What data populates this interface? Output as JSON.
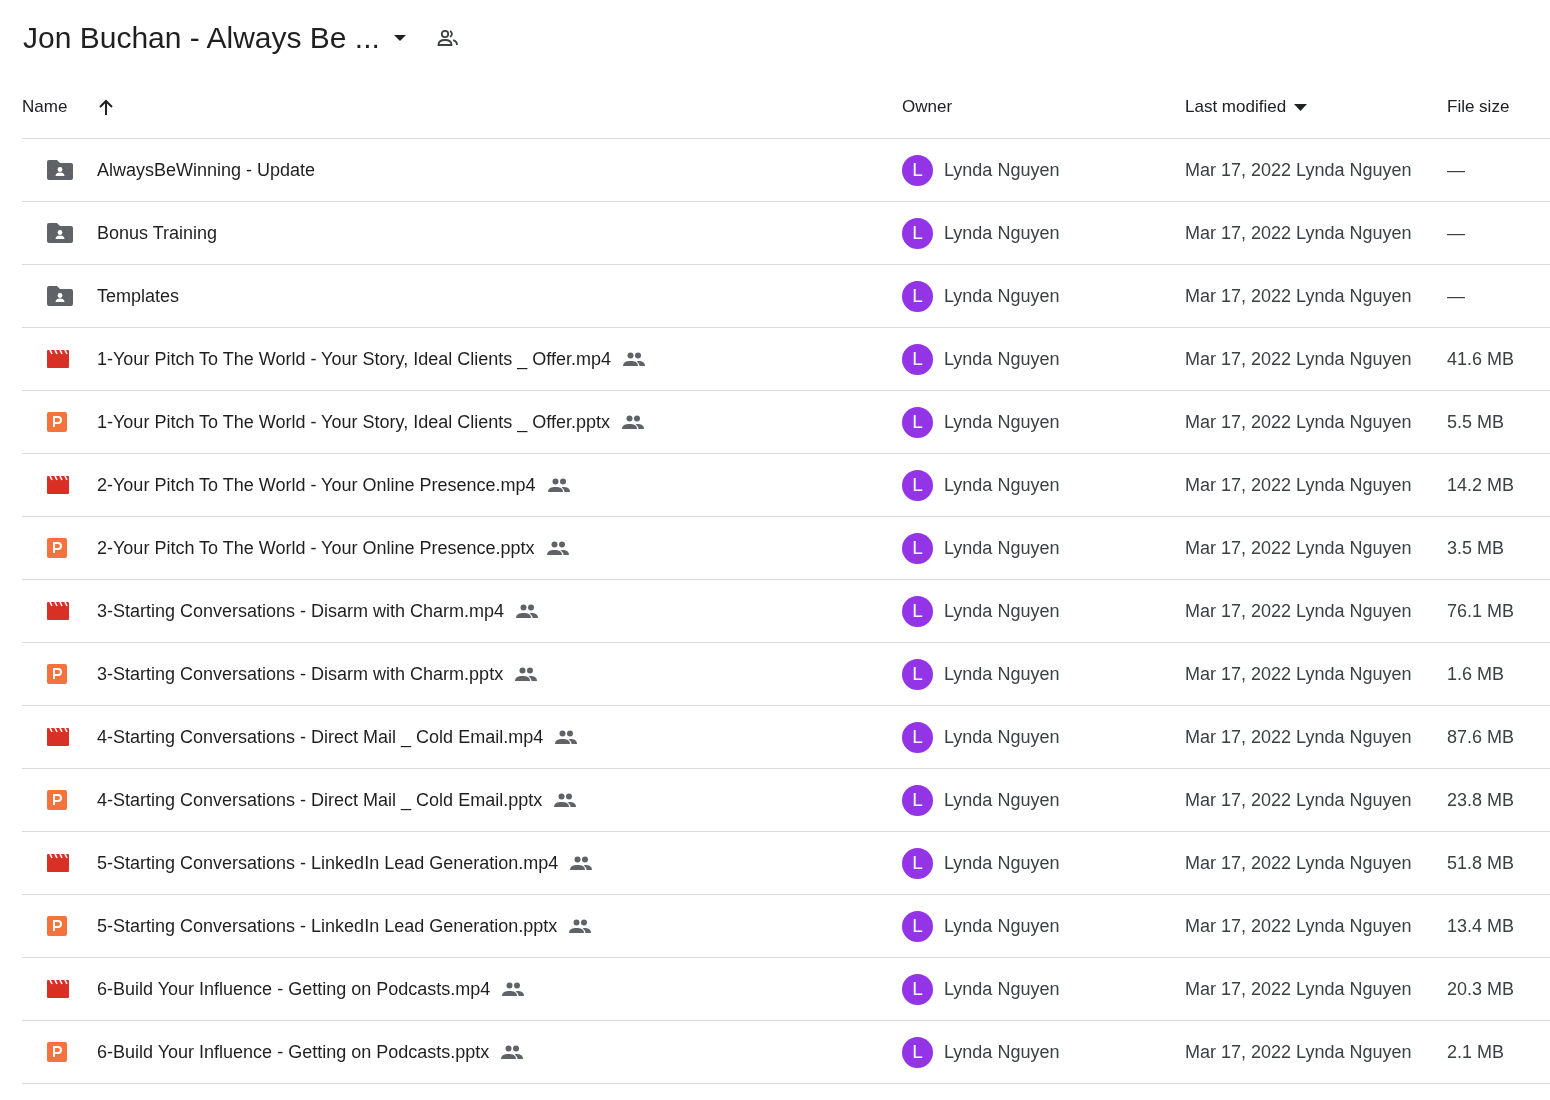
{
  "header": {
    "title": "Jon Buchan - Always Be ...",
    "shared": true
  },
  "table": {
    "columns": [
      {
        "label": "Name",
        "kind": "ascending"
      },
      {
        "label": "Owner",
        "kind": "plain"
      },
      {
        "label": "Last modified",
        "kind": "descending"
      },
      {
        "label": "File size",
        "kind": "plain"
      }
    ],
    "rows": [
      {
        "kind": "folder",
        "name": "AlwaysBeWinning - Update",
        "shared": false,
        "owner_avatar": "L",
        "owner": "Lynda Nguyen",
        "modified_date": "Mar 17, 2022",
        "modified_by": "Lynda Nguyen",
        "size": "—"
      },
      {
        "kind": "folder",
        "name": "Bonus Training",
        "shared": false,
        "owner_avatar": "L",
        "owner": "Lynda Nguyen",
        "modified_date": "Mar 17, 2022",
        "modified_by": "Lynda Nguyen",
        "size": "—"
      },
      {
        "kind": "folder",
        "name": "Templates",
        "shared": false,
        "owner_avatar": "L",
        "owner": "Lynda Nguyen",
        "modified_date": "Mar 17, 2022",
        "modified_by": "Lynda Nguyen",
        "size": "—"
      },
      {
        "kind": "video",
        "name": "1-Your Pitch To The World - Your Story, Ideal Clients _ Offer.mp4",
        "shared": true,
        "owner_avatar": "L",
        "owner": "Lynda Nguyen",
        "modified_date": "Mar 17, 2022",
        "modified_by": "Lynda Nguyen",
        "size": "41.6 MB"
      },
      {
        "kind": "slides",
        "name": "1-Your Pitch To The World - Your Story, Ideal Clients _ Offer.pptx",
        "shared": true,
        "owner_avatar": "L",
        "owner": "Lynda Nguyen",
        "modified_date": "Mar 17, 2022",
        "modified_by": "Lynda Nguyen",
        "size": "5.5 MB"
      },
      {
        "kind": "video",
        "name": "2-Your Pitch To The World - Your Online Presence.mp4",
        "shared": true,
        "owner_avatar": "L",
        "owner": "Lynda Nguyen",
        "modified_date": "Mar 17, 2022",
        "modified_by": "Lynda Nguyen",
        "size": "14.2 MB"
      },
      {
        "kind": "slides",
        "name": "2-Your Pitch To The World - Your Online Presence.pptx",
        "shared": true,
        "owner_avatar": "L",
        "owner": "Lynda Nguyen",
        "modified_date": "Mar 17, 2022",
        "modified_by": "Lynda Nguyen",
        "size": "3.5 MB"
      },
      {
        "kind": "video",
        "name": "3-Starting Conversations - Disarm with Charm.mp4",
        "shared": true,
        "owner_avatar": "L",
        "owner": "Lynda Nguyen",
        "modified_date": "Mar 17, 2022",
        "modified_by": "Lynda Nguyen",
        "size": "76.1 MB"
      },
      {
        "kind": "slides",
        "name": "3-Starting Conversations - Disarm with Charm.pptx",
        "shared": true,
        "owner_avatar": "L",
        "owner": "Lynda Nguyen",
        "modified_date": "Mar 17, 2022",
        "modified_by": "Lynda Nguyen",
        "size": "1.6 MB"
      },
      {
        "kind": "video",
        "name": "4-Starting Conversations -  Direct Mail _ Cold Email.mp4",
        "shared": true,
        "owner_avatar": "L",
        "owner": "Lynda Nguyen",
        "modified_date": "Mar 17, 2022",
        "modified_by": "Lynda Nguyen",
        "size": "87.6 MB"
      },
      {
        "kind": "slides",
        "name": "4-Starting Conversations -  Direct Mail _ Cold Email.pptx",
        "shared": true,
        "owner_avatar": "L",
        "owner": "Lynda Nguyen",
        "modified_date": "Mar 17, 2022",
        "modified_by": "Lynda Nguyen",
        "size": "23.8 MB"
      },
      {
        "kind": "video",
        "name": "5-Starting Conversations - LinkedIn Lead Generation.mp4",
        "shared": true,
        "owner_avatar": "L",
        "owner": "Lynda Nguyen",
        "modified_date": "Mar 17, 2022",
        "modified_by": "Lynda Nguyen",
        "size": "51.8 MB"
      },
      {
        "kind": "slides",
        "name": "5-Starting Conversations - LinkedIn Lead Generation.pptx",
        "shared": true,
        "owner_avatar": "L",
        "owner": "Lynda Nguyen",
        "modified_date": "Mar 17, 2022",
        "modified_by": "Lynda Nguyen",
        "size": "13.4 MB"
      },
      {
        "kind": "video",
        "name": "6-Build Your Influence - Getting on Podcasts.mp4",
        "shared": true,
        "owner_avatar": "L",
        "owner": "Lynda Nguyen",
        "modified_date": "Mar 17, 2022",
        "modified_by": "Lynda Nguyen",
        "size": "20.3 MB"
      },
      {
        "kind": "slides",
        "name": "6-Build Your Influence - Getting on Podcasts.pptx",
        "shared": true,
        "owner_avatar": "L",
        "owner": "Lynda Nguyen",
        "modified_date": "Mar 17, 2022",
        "modified_by": "Lynda Nguyen",
        "size": "2.1 MB"
      }
    ]
  }
}
